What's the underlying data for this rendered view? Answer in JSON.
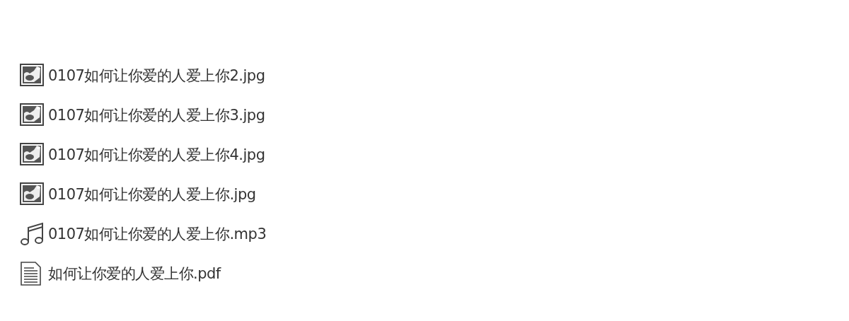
{
  "files": [
    {
      "kind": "image",
      "name": "0107如何让你爱的人爱上你2.jpg"
    },
    {
      "kind": "image",
      "name": "0107如何让你爱的人爱上你3.jpg"
    },
    {
      "kind": "image",
      "name": "0107如何让你爱的人爱上你4.jpg"
    },
    {
      "kind": "image",
      "name": "0107如何让你爱的人爱上你.jpg"
    },
    {
      "kind": "audio",
      "name": "0107如何让你爱的人爱上你.mp3"
    },
    {
      "kind": "document",
      "name": "如何让你爱的人爱上你.pdf"
    }
  ]
}
